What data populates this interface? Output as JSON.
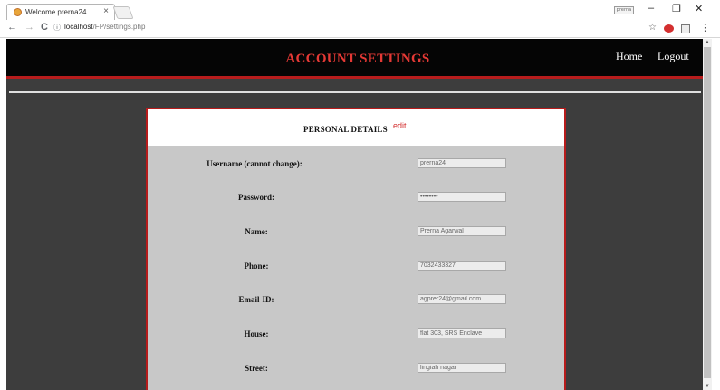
{
  "browser": {
    "tab_title": "Welcome prerna24",
    "tab_close": "×",
    "profile_chip": "prerna",
    "minimize": "–",
    "maximize": "❐",
    "close": "✕",
    "back": "←",
    "forward": "→",
    "reload": "C",
    "info_icon": "ⓘ",
    "url_host": "localhost",
    "url_path": "/FP/settings.php",
    "star": "☆",
    "menu": "⋮"
  },
  "header": {
    "title": "ACCOUNT SETTINGS",
    "home": "Home",
    "logout": "Logout"
  },
  "card": {
    "title": "PERSONAL DETAILS",
    "edit": "edit",
    "fields": [
      {
        "label": "Username (cannot change):",
        "value": "prerna24"
      },
      {
        "label": "Password:",
        "value": "••••••••"
      },
      {
        "label": "Name:",
        "value": "Prerna Agarwal"
      },
      {
        "label": "Phone:",
        "value": "7032433327"
      },
      {
        "label": "Email-ID:",
        "value": "agprer24@gmail.com"
      },
      {
        "label": "House:",
        "value": "flat 303, SRS Enclave"
      },
      {
        "label": "Street:",
        "value": "lingiah nagar"
      }
    ]
  },
  "colors": {
    "header_bg": "#050505",
    "accent": "#b71c1c",
    "title_red": "#e53935",
    "page_bg": "#3d3d3d",
    "card_bg": "#c8c8c8"
  }
}
